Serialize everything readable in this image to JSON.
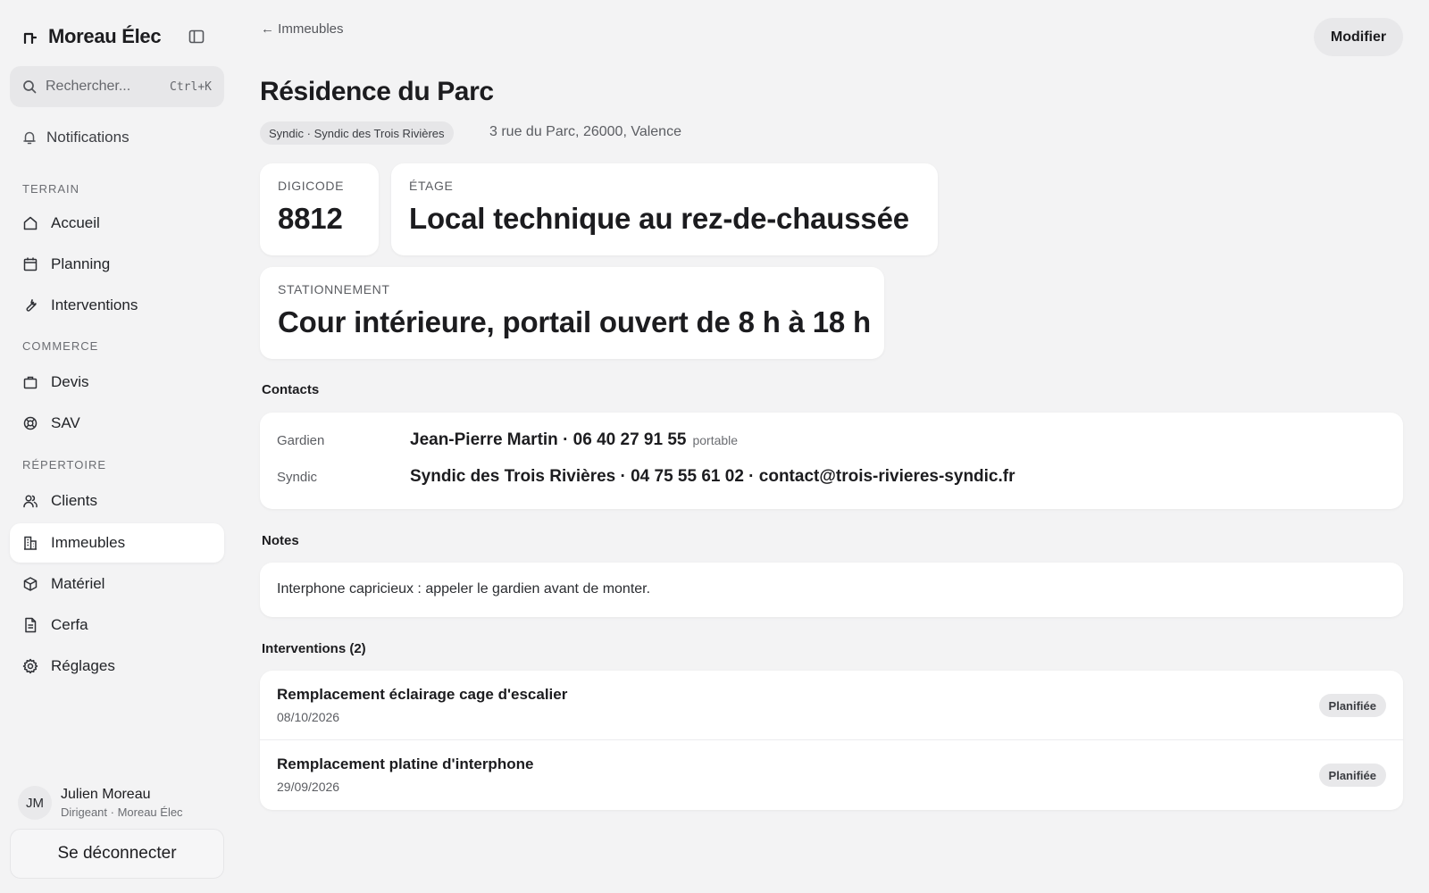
{
  "app": {
    "name": "Moreau Élec"
  },
  "search": {
    "placeholder": "Rechercher...",
    "shortcut": "Ctrl+K"
  },
  "notifications": {
    "label": "Notifications"
  },
  "sidebar": {
    "sections": [
      {
        "title": "TERRAIN",
        "items": [
          {
            "label": "Accueil",
            "icon": "home-icon"
          },
          {
            "label": "Planning",
            "icon": "calendar-icon"
          },
          {
            "label": "Interventions",
            "icon": "wrench-icon"
          }
        ]
      },
      {
        "title": "COMMERCE",
        "items": [
          {
            "label": "Devis",
            "icon": "briefcase-icon"
          },
          {
            "label": "SAV",
            "icon": "lifebuoy-icon"
          }
        ]
      },
      {
        "title": "RÉPERTOIRE",
        "items": [
          {
            "label": "Clients",
            "icon": "users-icon"
          },
          {
            "label": "Immeubles",
            "icon": "building-icon",
            "active": true
          },
          {
            "label": "Matériel",
            "icon": "package-icon"
          },
          {
            "label": "Cerfa",
            "icon": "document-icon"
          },
          {
            "label": "Réglages",
            "icon": "gear-icon"
          }
        ]
      }
    ]
  },
  "user": {
    "initials": "JM",
    "name": "Julien Moreau",
    "role": "Dirigeant · Moreau Élec"
  },
  "logout": {
    "label": "Se déconnecter"
  },
  "header": {
    "back_label": "← Immeubles",
    "edit_label": "Modifier"
  },
  "building": {
    "title": "Résidence du Parc",
    "tag": "Syndic · Syndic des Trois Rivières",
    "address": "3 rue du Parc, 26000, Valence",
    "digicode": {
      "label": "DIGICODE",
      "value": "8812"
    },
    "etage": {
      "label": "ÉTAGE",
      "value": "Local technique au rez-de-chaussée"
    },
    "stationnement": {
      "label": "STATIONNEMENT",
      "value": "Cour intérieure, portail ouvert de 8 h à 18 h"
    }
  },
  "contacts": {
    "title": "Contacts",
    "items": [
      {
        "role": "Gardien",
        "value": "Jean-Pierre Martin · 06 40 27 91 55",
        "note": "portable"
      },
      {
        "role": "Syndic",
        "value": "Syndic des Trois Rivières · 04 75 55 61 02 · contact@trois-rivieres-syndic.fr",
        "note": ""
      }
    ]
  },
  "notes": {
    "title": "Notes",
    "text": "Interphone capricieux : appeler le gardien avant de monter."
  },
  "interventions": {
    "title": "Interventions (2)",
    "items": [
      {
        "title": "Remplacement éclairage cage d'escalier",
        "date": "08/10/2026",
        "status": "Planifiée"
      },
      {
        "title": "Remplacement platine d'interphone",
        "date": "29/09/2026",
        "status": "Planifiée"
      }
    ]
  }
}
